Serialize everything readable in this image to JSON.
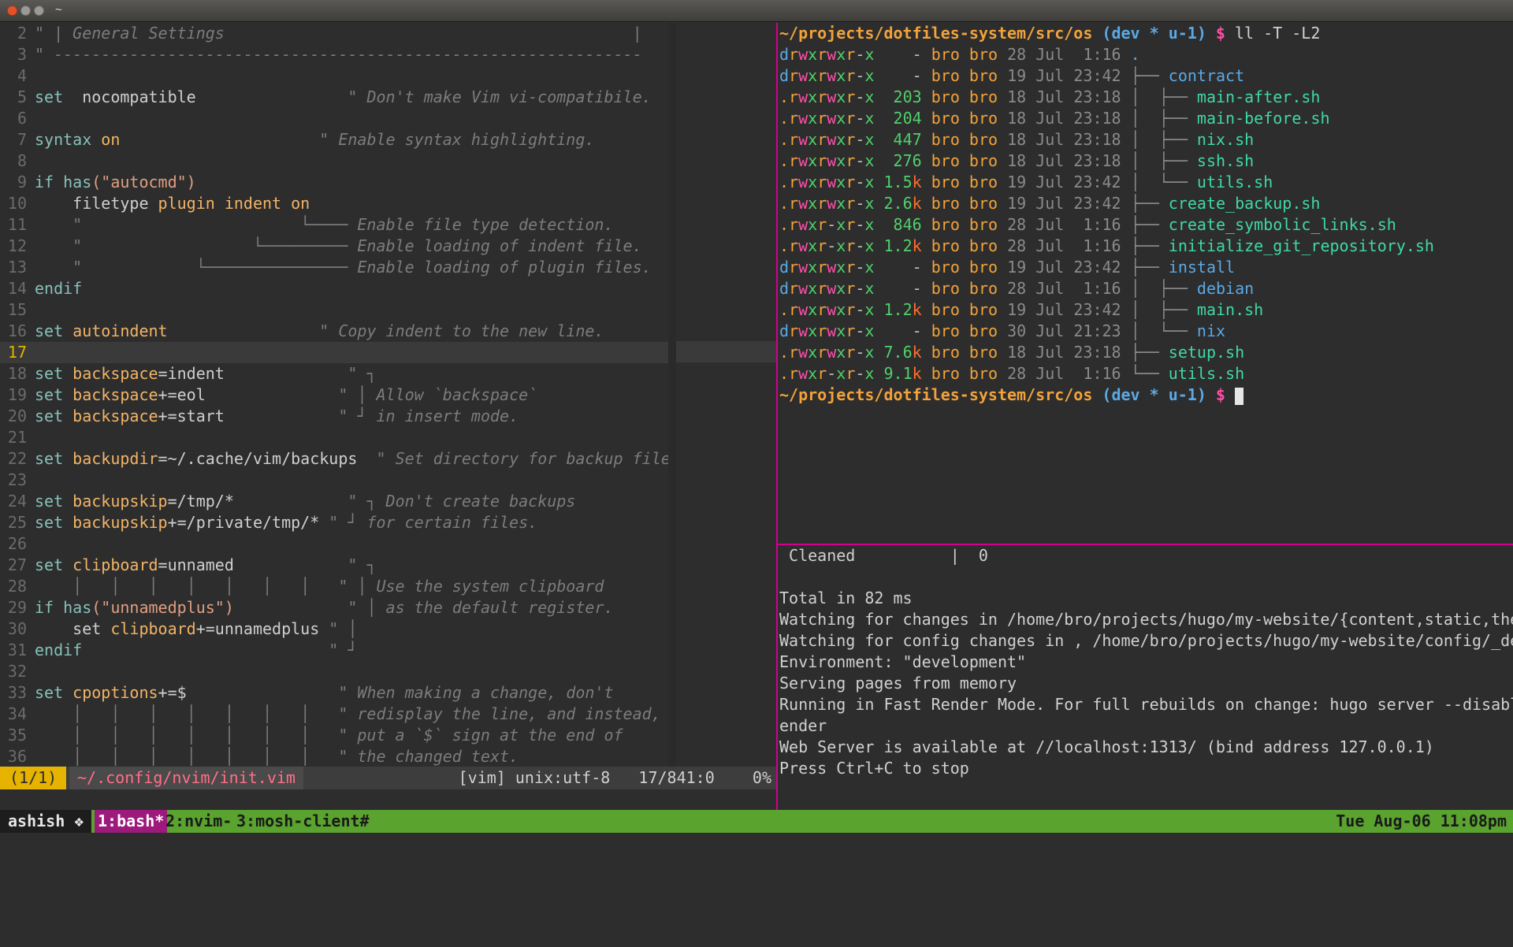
{
  "window": {
    "title": "~"
  },
  "vim": {
    "lines": [
      {
        "n": "2",
        "segs": [
          [
            "cm",
            "\" | General Settings                                           |"
          ]
        ]
      },
      {
        "n": "3",
        "segs": [
          [
            "cm",
            "\" --------------------------------------------------------------"
          ]
        ]
      },
      {
        "n": "4",
        "segs": []
      },
      {
        "n": "5",
        "segs": [
          [
            "kw",
            "set"
          ],
          [
            "",
            "  nocompatible"
          ],
          [
            "cm",
            "                \" Don't make Vim vi-compatibile."
          ]
        ]
      },
      {
        "n": "6",
        "segs": []
      },
      {
        "n": "7",
        "segs": [
          [
            "kw",
            "syntax"
          ],
          [
            "opt",
            " on"
          ],
          [
            "cm",
            "                     \" Enable syntax highlighting."
          ]
        ]
      },
      {
        "n": "8",
        "segs": []
      },
      {
        "n": "9",
        "segs": [
          [
            "kw",
            "if"
          ],
          [
            "fn",
            " has"
          ],
          [
            "str",
            "(\"autocmd\")"
          ]
        ]
      },
      {
        "n": "10",
        "segs": [
          [
            "",
            "    filetype"
          ],
          [
            "opt",
            " plugin indent on"
          ]
        ]
      },
      {
        "n": "11",
        "segs": [
          [
            "cm",
            "    \"                       └──── Enable file type detection."
          ]
        ]
      },
      {
        "n": "12",
        "segs": [
          [
            "cm",
            "    \"                  └───────── Enable loading of indent file."
          ]
        ]
      },
      {
        "n": "13",
        "segs": [
          [
            "cm",
            "    \"            └─────────────── Enable loading of plugin files."
          ]
        ]
      },
      {
        "n": "14",
        "segs": [
          [
            "kw",
            "endif"
          ]
        ]
      },
      {
        "n": "15",
        "segs": []
      },
      {
        "n": "16",
        "segs": [
          [
            "kw",
            "set"
          ],
          [
            "opt",
            " autoindent"
          ],
          [
            "cm",
            "                \" Copy indent to the new line."
          ]
        ]
      },
      {
        "n": "17",
        "cur": true,
        "segs": []
      },
      {
        "n": "18",
        "segs": [
          [
            "kw",
            "set"
          ],
          [
            "opt",
            " backspace"
          ],
          [
            "",
            "=indent"
          ],
          [
            "cm",
            "             \" ┐"
          ]
        ]
      },
      {
        "n": "19",
        "segs": [
          [
            "kw",
            "set"
          ],
          [
            "opt",
            " backspace"
          ],
          [
            "",
            "+=eol"
          ],
          [
            "cm",
            "              \" │ Allow `backspace`"
          ]
        ]
      },
      {
        "n": "20",
        "segs": [
          [
            "kw",
            "set"
          ],
          [
            "opt",
            " backspace"
          ],
          [
            "",
            "+=start"
          ],
          [
            "cm",
            "            \" ┘ in insert mode."
          ]
        ]
      },
      {
        "n": "21",
        "segs": []
      },
      {
        "n": "22",
        "segs": [
          [
            "kw",
            "set"
          ],
          [
            "opt",
            " backupdir"
          ],
          [
            "",
            "=~/.cache/vim/backups"
          ],
          [
            "cm",
            "  \" Set directory for backup files."
          ]
        ]
      },
      {
        "n": "23",
        "segs": []
      },
      {
        "n": "24",
        "segs": [
          [
            "kw",
            "set"
          ],
          [
            "opt",
            " backupskip"
          ],
          [
            "",
            "=/tmp/*"
          ],
          [
            "cm",
            "            \" ┐ Don't create backups"
          ]
        ]
      },
      {
        "n": "25",
        "segs": [
          [
            "kw",
            "set"
          ],
          [
            "opt",
            " backupskip"
          ],
          [
            "",
            "+=/private/tmp/*"
          ],
          [
            "cm",
            " \" ┘ for certain files."
          ]
        ]
      },
      {
        "n": "26",
        "segs": []
      },
      {
        "n": "27",
        "segs": [
          [
            "kw",
            "set"
          ],
          [
            "opt",
            " clipboard"
          ],
          [
            "",
            "=unnamed"
          ],
          [
            "cm",
            "            \" ┐"
          ]
        ]
      },
      {
        "n": "28",
        "segs": [
          [
            "cm",
            "    │   │   │   │   │   │   │   \" │ Use the system clipboard"
          ]
        ]
      },
      {
        "n": "29",
        "segs": [
          [
            "kw",
            "if"
          ],
          [
            "fn",
            " has"
          ],
          [
            "str",
            "(\"unnamedplus\")"
          ],
          [
            "cm",
            "            \" │ as the default register."
          ]
        ]
      },
      {
        "n": "30",
        "segs": [
          [
            "",
            "    set"
          ],
          [
            "opt",
            " clipboard"
          ],
          [
            "",
            "+=unnamedplus"
          ],
          [
            "cm",
            " \" │"
          ]
        ]
      },
      {
        "n": "31",
        "segs": [
          [
            "kw",
            "endif"
          ],
          [
            "cm",
            "                          \" ┘"
          ]
        ]
      },
      {
        "n": "32",
        "segs": []
      },
      {
        "n": "33",
        "segs": [
          [
            "kw",
            "set"
          ],
          [
            "opt",
            " cpoptions"
          ],
          [
            "",
            "+=$"
          ],
          [
            "cm",
            "                \" When making a change, don't"
          ]
        ]
      },
      {
        "n": "34",
        "segs": [
          [
            "cm",
            "    │   │   │   │   │   │   │   \" redisplay the line, and instead,"
          ]
        ]
      },
      {
        "n": "35",
        "segs": [
          [
            "cm",
            "    │   │   │   │   │   │   │   \" put a `$` sign at the end of"
          ]
        ]
      },
      {
        "n": "36",
        "segs": [
          [
            "cm",
            "    │   │   │   │   │   │   │   \" the changed text."
          ]
        ]
      }
    ],
    "status": {
      "mode": "(1/1)",
      "file": "~/.config/nvim/init.vim",
      "right": "[vim] unix:utf-8   17/841:0    0%"
    }
  },
  "terminal": {
    "prompt": {
      "path": "~/projects/dotfiles-system/src/os",
      "git": "(dev * u-1)",
      "dollar": "$"
    },
    "command": "ll -T -L2",
    "listing": [
      {
        "perm": "drwxrwxr-x",
        "size": "-",
        "user": "bro bro",
        "date": "28 Jul  1:16",
        "tree": "",
        "name": ".",
        "kind": "dot"
      },
      {
        "perm": "drwxrwxr-x",
        "size": "-",
        "user": "bro bro",
        "date": "19 Jul 23:42",
        "tree": "├── ",
        "name": "contract",
        "kind": "dir"
      },
      {
        "perm": ".rwxrwxr-x",
        "size": "203",
        "user": "bro bro",
        "date": "18 Jul 23:18",
        "tree": "│  ├── ",
        "name": "main-after.sh",
        "kind": "file"
      },
      {
        "perm": ".rwxrwxr-x",
        "size": "204",
        "user": "bro bro",
        "date": "18 Jul 23:18",
        "tree": "│  ├── ",
        "name": "main-before.sh",
        "kind": "file"
      },
      {
        "perm": ".rwxrwxr-x",
        "size": "447",
        "user": "bro bro",
        "date": "18 Jul 23:18",
        "tree": "│  ├── ",
        "name": "nix.sh",
        "kind": "file"
      },
      {
        "perm": ".rwxrwxr-x",
        "size": "276",
        "user": "bro bro",
        "date": "18 Jul 23:18",
        "tree": "│  ├── ",
        "name": "ssh.sh",
        "kind": "file"
      },
      {
        "perm": ".rwxrwxr-x",
        "size": "1.5k",
        "user": "bro bro",
        "date": "19 Jul 23:42",
        "tree": "│  └── ",
        "name": "utils.sh",
        "kind": "file"
      },
      {
        "perm": ".rwxrwxr-x",
        "size": "2.6k",
        "user": "bro bro",
        "date": "19 Jul 23:42",
        "tree": "├── ",
        "name": "create_backup.sh",
        "kind": "file"
      },
      {
        "perm": ".rwxr-xr-x",
        "size": "846",
        "user": "bro bro",
        "date": "28 Jul  1:16",
        "tree": "├── ",
        "name": "create_symbolic_links.sh",
        "kind": "file"
      },
      {
        "perm": ".rwxr-xr-x",
        "size": "1.2k",
        "user": "bro bro",
        "date": "28 Jul  1:16",
        "tree": "├── ",
        "name": "initialize_git_repository.sh",
        "kind": "file"
      },
      {
        "perm": "drwxrwxr-x",
        "size": "-",
        "user": "bro bro",
        "date": "19 Jul 23:42",
        "tree": "├── ",
        "name": "install",
        "kind": "dir"
      },
      {
        "perm": "drwxrwxr-x",
        "size": "-",
        "user": "bro bro",
        "date": "28 Jul  1:16",
        "tree": "│  ├── ",
        "name": "debian",
        "kind": "dir"
      },
      {
        "perm": ".rwxrwxr-x",
        "size": "1.2k",
        "user": "bro bro",
        "date": "19 Jul 23:42",
        "tree": "│  ├── ",
        "name": "main.sh",
        "kind": "file"
      },
      {
        "perm": "drwxrwxr-x",
        "size": "-",
        "user": "bro bro",
        "date": "30 Jul 21:23",
        "tree": "│  └── ",
        "name": "nix",
        "kind": "dir"
      },
      {
        "perm": ".rwxrwxr-x",
        "size": "7.6k",
        "user": "bro bro",
        "date": "18 Jul 23:18",
        "tree": "├── ",
        "name": "setup.sh",
        "kind": "file"
      },
      {
        "perm": ".rwxr-xr-x",
        "size": "9.1k",
        "user": "bro bro",
        "date": "28 Jul  1:16",
        "tree": "└── ",
        "name": "utils.sh",
        "kind": "file"
      }
    ]
  },
  "hugo": {
    "lines": [
      " Cleaned          |  0",
      "",
      "Total in 82 ms",
      "Watching for changes in /home/bro/projects/hugo/my-website/{content,static,themes}",
      "Watching for config changes in , /home/bro/projects/hugo/my-website/config/_default",
      "Environment: \"development\"",
      "Serving pages from memory",
      "Running in Fast Render Mode. For full rebuilds on change: hugo server --disableFastR",
      "ender",
      "Web Server is available at //localhost:1313/ (bind address 127.0.0.1)",
      "Press Ctrl+C to stop"
    ]
  },
  "tmux": {
    "session": "ashish ❖",
    "windows": [
      "1:bash*",
      "2:nvim-",
      "3:mosh-client#"
    ],
    "clock": "Tue Aug-06 11:08pm"
  }
}
